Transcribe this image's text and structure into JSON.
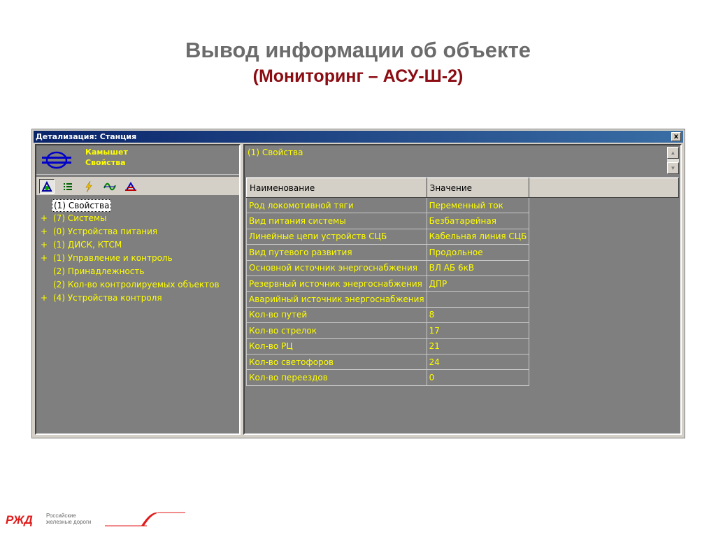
{
  "slide": {
    "title": "Вывод информации об объекте",
    "subtitle": "(Мониторинг – АСУ-Ш-2)"
  },
  "window": {
    "title": "Детализация: Станция",
    "close_label": "x"
  },
  "station": {
    "name": "Камышет",
    "subtitle": "Свойства"
  },
  "toolbar": {
    "buttons": [
      "properties-icon",
      "list-icon",
      "lightning-icon",
      "signal-icon",
      "station-track-icon"
    ]
  },
  "tree": {
    "items": [
      {
        "expander": "",
        "label": "(1) Свойства",
        "selected": true
      },
      {
        "expander": "+",
        "label": "(7) Системы"
      },
      {
        "expander": "+",
        "label": "(0) Устройства питания"
      },
      {
        "expander": "+",
        "label": "(1) ДИСК, КТСМ"
      },
      {
        "expander": "+",
        "label": "(1) Управление и контроль"
      },
      {
        "expander": "",
        "label": "(2) Принадлежность"
      },
      {
        "expander": "",
        "label": "(2) Кол-во контролируемых объектов"
      },
      {
        "expander": "+",
        "label": "(4) Устройства контроля"
      }
    ]
  },
  "properties": {
    "title": "(1) Свойства",
    "columns": [
      "Наименование",
      "Значение"
    ],
    "rows": [
      [
        "Род локомотивной тяги",
        "Переменный ток"
      ],
      [
        "Вид питания системы",
        "Безбатарейная"
      ],
      [
        "Линейные цепи устройств СЦБ",
        "Кабельная линия СЦБ"
      ],
      [
        "Вид путевого развития",
        "Продольное"
      ],
      [
        "Основной источник энергоснабжения",
        "ВЛ АБ 6кВ"
      ],
      [
        "Резервный источник энергоснабжения",
        "ДПР"
      ],
      [
        "Аварийный источник энергоснабжения",
        ""
      ],
      [
        "Кол-во путей",
        "8"
      ],
      [
        "Кол-во стрелок",
        "17"
      ],
      [
        "Кол-во РЦ",
        "21"
      ],
      [
        "Кол-во светофоров",
        "24"
      ],
      [
        "Кол-во переездов",
        "0"
      ]
    ]
  },
  "footer": {
    "brand": "РЖД",
    "line1": "Российские",
    "line2": "железные дороги"
  },
  "colors": {
    "title_gray": "#6b6b6b",
    "subtitle_red": "#8b0c12",
    "pane_bg": "#7f7f7f",
    "text_yellow": "#ffff00",
    "titlebar_blue": "#0a246a",
    "brand_red": "#e21a1a"
  }
}
